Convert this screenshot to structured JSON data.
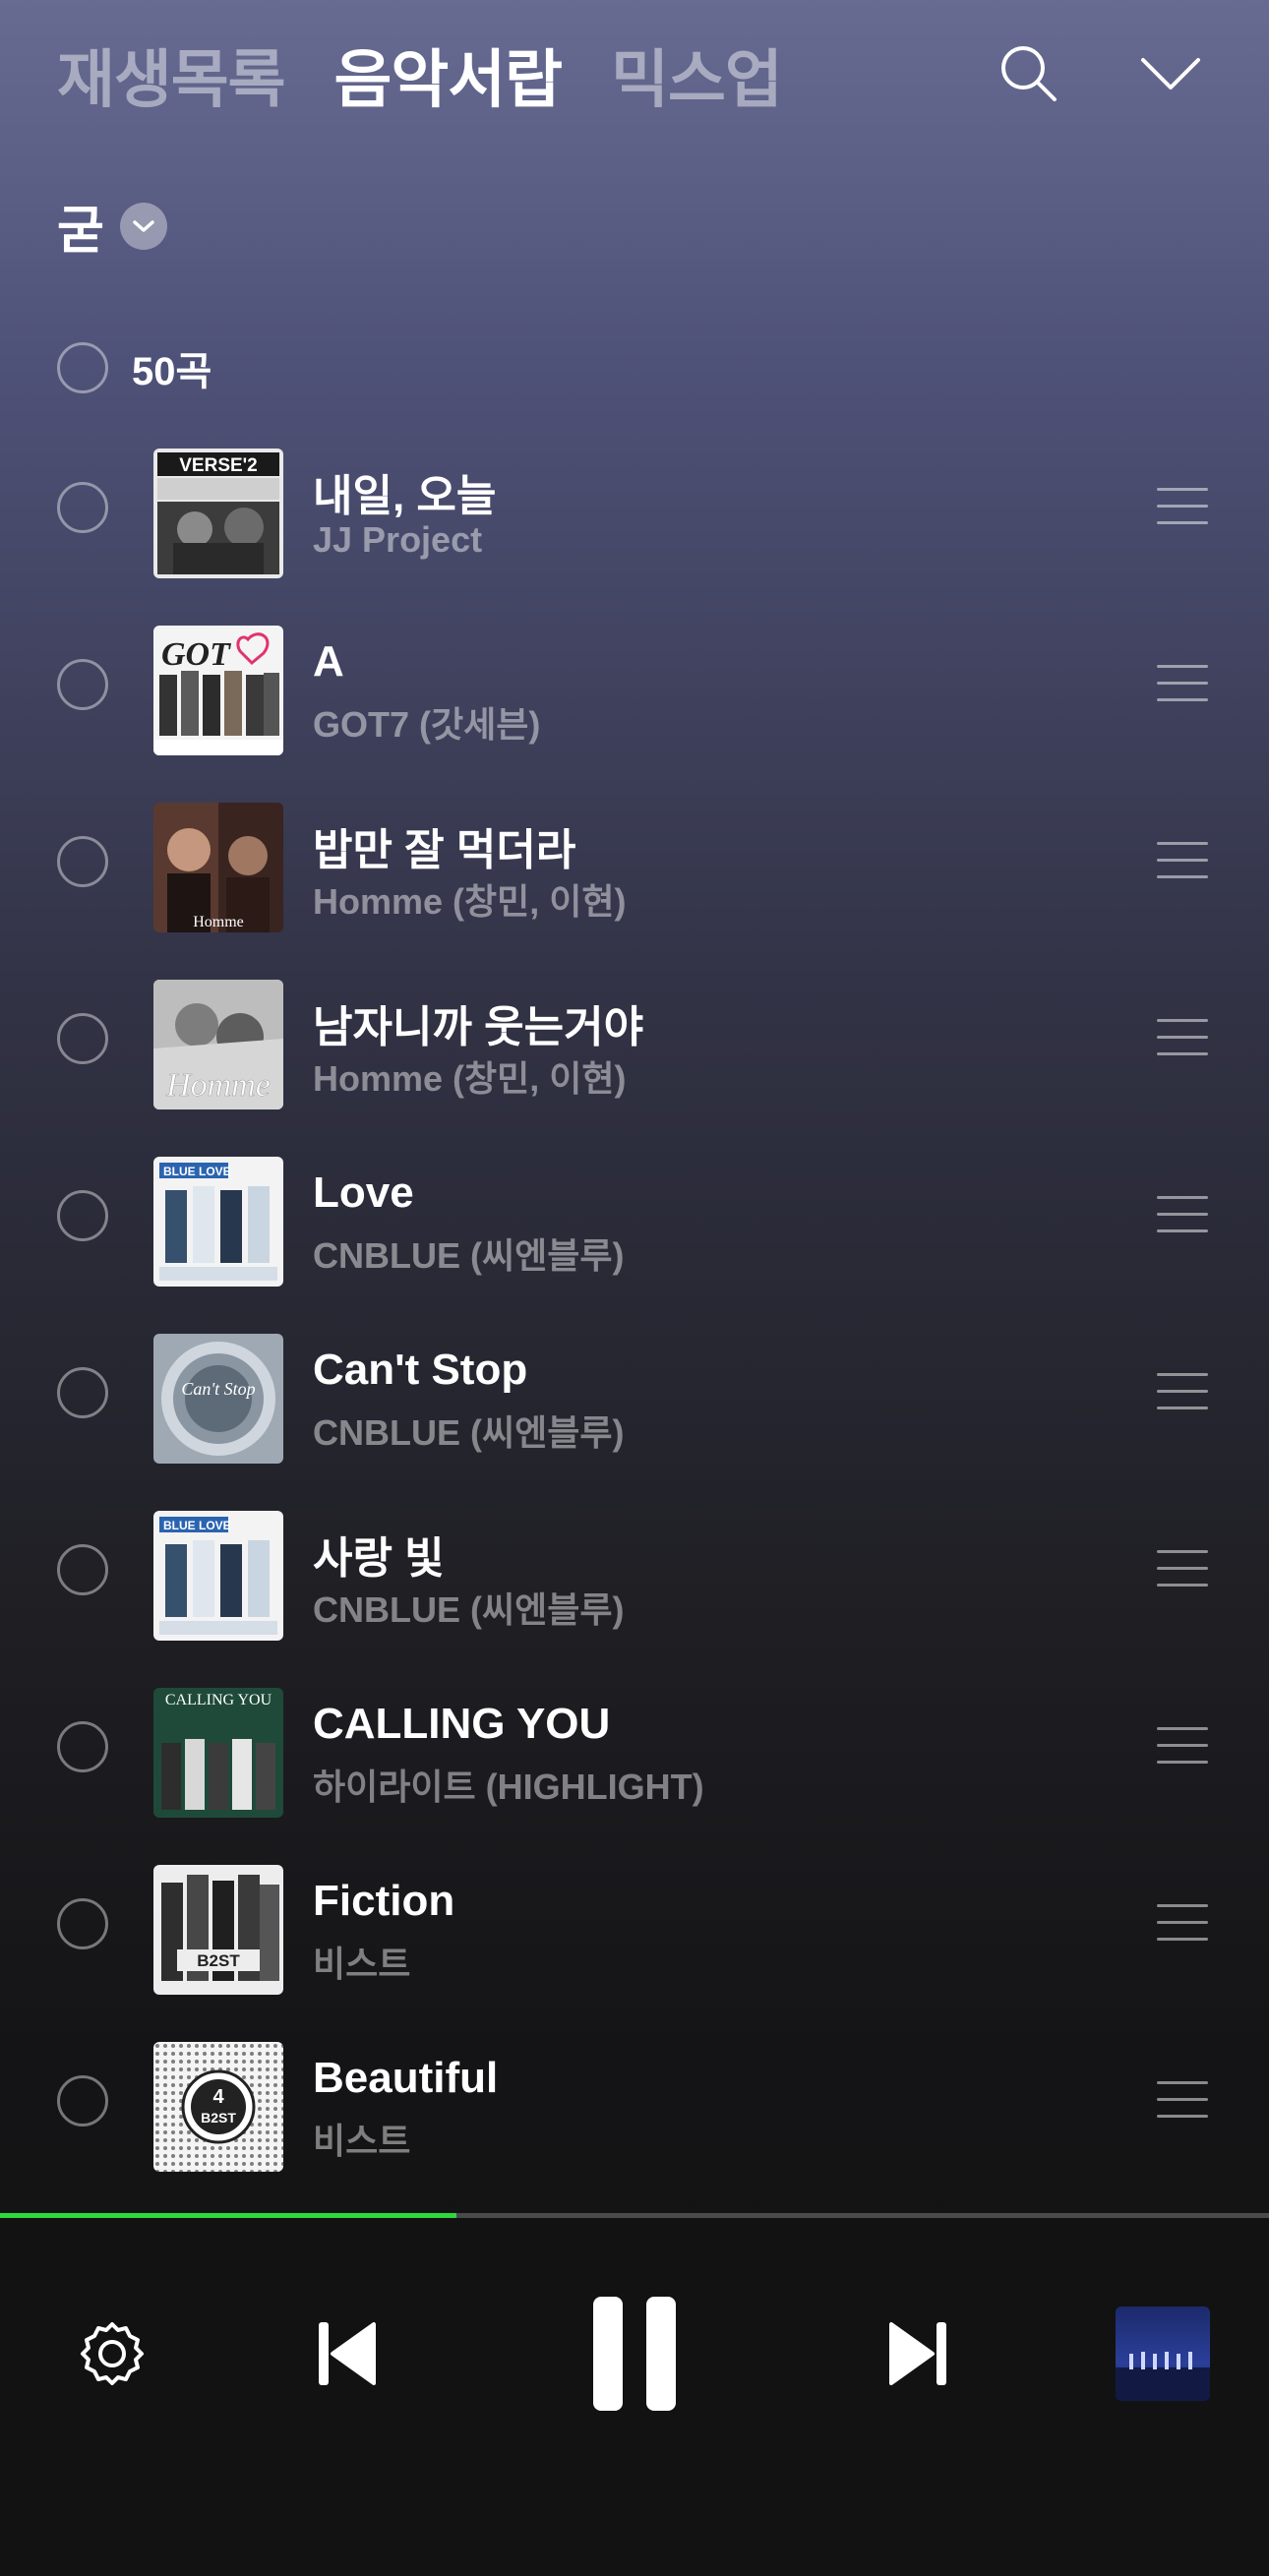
{
  "header": {
    "tabs": [
      {
        "label": "재생목록",
        "active": false
      },
      {
        "label": "음악서랍",
        "active": true
      },
      {
        "label": "믹스업",
        "active": false
      }
    ],
    "icons": [
      "search-icon",
      "chevron-down-icon"
    ]
  },
  "filter": {
    "label": "굳",
    "icon": "chevron-down-icon"
  },
  "list": {
    "count_label": "50곡",
    "songs": [
      {
        "title": "내일, 오늘",
        "artist": "JJ Project"
      },
      {
        "title": "A",
        "artist": "GOT7 (갓세븐)"
      },
      {
        "title": "밥만 잘 먹더라",
        "artist": "Homme (창민, 이현)"
      },
      {
        "title": "남자니까 웃는거야",
        "artist": "Homme (창민, 이현)"
      },
      {
        "title": "Love",
        "artist": "CNBLUE (씨엔블루)"
      },
      {
        "title": "Can't Stop",
        "artist": "CNBLUE (씨엔블루)"
      },
      {
        "title": "사랑 빛",
        "artist": "CNBLUE (씨엔블루)"
      },
      {
        "title": "CALLING YOU",
        "artist": "하이라이트 (HIGHLIGHT)"
      },
      {
        "title": "Fiction",
        "artist": "비스트"
      },
      {
        "title": "Beautiful",
        "artist": "비스트"
      }
    ],
    "album_art_text": [
      "VERSE'2",
      "GOT",
      "Homme",
      "Homme",
      "BLUE LOVE",
      "Can't Stop",
      "BLUE LOVE",
      "CALLING YOU",
      "B2ST",
      "B2ST"
    ]
  },
  "player": {
    "progress": 0.36,
    "controls": [
      "settings-icon",
      "previous-icon",
      "pause-icon",
      "next-icon"
    ]
  },
  "colors": {
    "accent": "#2fd83f",
    "bg_top": "#676b92",
    "bg_bottom": "#121212"
  }
}
